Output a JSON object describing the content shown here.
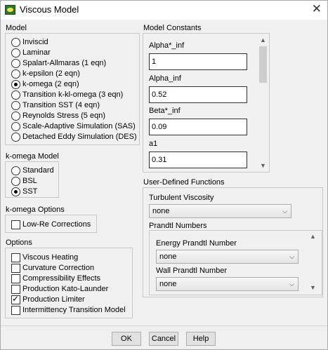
{
  "window": {
    "title": "Viscous Model",
    "close_glyph": "✕"
  },
  "model": {
    "label": "Model",
    "options": [
      {
        "label": "Inviscid",
        "selected": false
      },
      {
        "label": "Laminar",
        "selected": false
      },
      {
        "label": "Spalart-Allmaras (1 eqn)",
        "selected": false
      },
      {
        "label": "k-epsilon (2 eqn)",
        "selected": false
      },
      {
        "label": "k-omega (2 eqn)",
        "selected": true
      },
      {
        "label": "Transition k-kl-omega (3 eqn)",
        "selected": false
      },
      {
        "label": "Transition SST (4 eqn)",
        "selected": false
      },
      {
        "label": "Reynolds Stress (5 eqn)",
        "selected": false
      },
      {
        "label": "Scale-Adaptive Simulation (SAS)",
        "selected": false
      },
      {
        "label": "Detached Eddy Simulation (DES)",
        "selected": false
      }
    ]
  },
  "komega_model": {
    "label": "k-omega Model",
    "options": [
      {
        "label": "Standard",
        "selected": false
      },
      {
        "label": "BSL",
        "selected": false
      },
      {
        "label": "SST",
        "selected": true
      }
    ]
  },
  "komega_options": {
    "label": "k-omega Options",
    "low_re": {
      "label": "Low-Re Corrections",
      "checked": false
    }
  },
  "options": {
    "label": "Options",
    "items": [
      {
        "label": "Viscous Heating",
        "checked": false
      },
      {
        "label": "Curvature Correction",
        "checked": false
      },
      {
        "label": "Compressibility Effects",
        "checked": false
      },
      {
        "label": "Production Kato-Launder",
        "checked": false
      },
      {
        "label": "Production Limiter",
        "checked": true
      },
      {
        "label": "Intermittency Transition Model",
        "checked": false
      }
    ]
  },
  "model_constants": {
    "label": "Model Constants",
    "items": [
      {
        "label": "Alpha*_inf",
        "value": "1"
      },
      {
        "label": "Alpha_inf",
        "value": "0.52"
      },
      {
        "label": "Beta*_inf",
        "value": "0.09"
      },
      {
        "label": "a1",
        "value": "0.31"
      }
    ]
  },
  "udf": {
    "label": "User-Defined Functions",
    "turbulent_viscosity": {
      "label": "Turbulent Viscosity",
      "value": "none"
    },
    "prandtl": {
      "label": "Prandtl Numbers",
      "energy": {
        "label": "Energy Prandtl Number",
        "value": "none"
      },
      "wall": {
        "label": "Wall Prandtl Number",
        "value": "none"
      }
    }
  },
  "buttons": {
    "ok": "OK",
    "cancel": "Cancel",
    "help": "Help"
  },
  "icons": {
    "app": "fluent-app-icon",
    "checkmark": "✓",
    "caret_down": "⌵",
    "scroll_up": "▲",
    "scroll_down": "▼"
  }
}
